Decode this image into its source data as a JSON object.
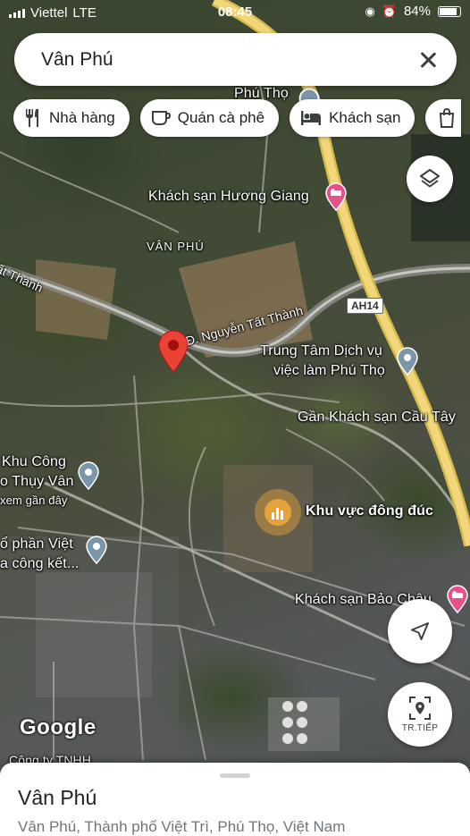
{
  "status_bar": {
    "carrier": "Viettel",
    "network": "LTE",
    "time": "08:45",
    "battery": "84%"
  },
  "search": {
    "query": "Vân Phú",
    "close_icon": "close-icon"
  },
  "chips": [
    {
      "label": "Nhà hàng",
      "icon": "restaurant-icon"
    },
    {
      "label": "Quán cà phê",
      "icon": "coffee-icon"
    },
    {
      "label": "Khách sạn",
      "icon": "hotel-icon"
    },
    {
      "label": "",
      "icon": "shopping-icon"
    }
  ],
  "map": {
    "labels": {
      "phu_tho": "Phú Thọ",
      "huong_giang": "Khách sạn Hương Giang",
      "van_phu": "VÂN PHÚ",
      "tat_thanh": "ất Thành",
      "nguyen_tat_thanh": "Đ. Nguyễn Tất Thành",
      "ah14": "AH14",
      "dich_vu_line1": "Trung Tâm Dịch vụ",
      "dich_vu_line2": "việc làm Phú Thọ",
      "gan_cau_tay": "Gần Khách sạn Cầu Tây",
      "khu_cong_line1": "Khu Công",
      "khu_cong_line2": "o Thụy Vân",
      "khu_cong_line3": "xem gần đây",
      "khu_dong_duc": "Khu vực đông đúc",
      "co_phan_line1": "ổ phần Việt",
      "co_phan_line2": "a công kết...",
      "bao_chau": "Khách sạn Bảo Châu",
      "cong_ty": "Công ty TNHH"
    },
    "logo": "Google",
    "colors": {
      "highway": "#f2d77a",
      "road": "#bfbfbf",
      "selected_pin": "#ea4335",
      "hotel_pin": "#e8508a",
      "crowded_badge": "#e6a23c",
      "poi_pin": "#5f7a8c"
    }
  },
  "controls": {
    "layers_icon": "layers-icon",
    "locate_icon": "navigation-arrow-icon",
    "directions_icon": "directions-pin-icon",
    "directions_label": "TR.TIẾP"
  },
  "sheet": {
    "title": "Vân Phú",
    "address": "Vân Phú, Thành phố Việt Trì, Phú Thọ, Việt Nam"
  }
}
